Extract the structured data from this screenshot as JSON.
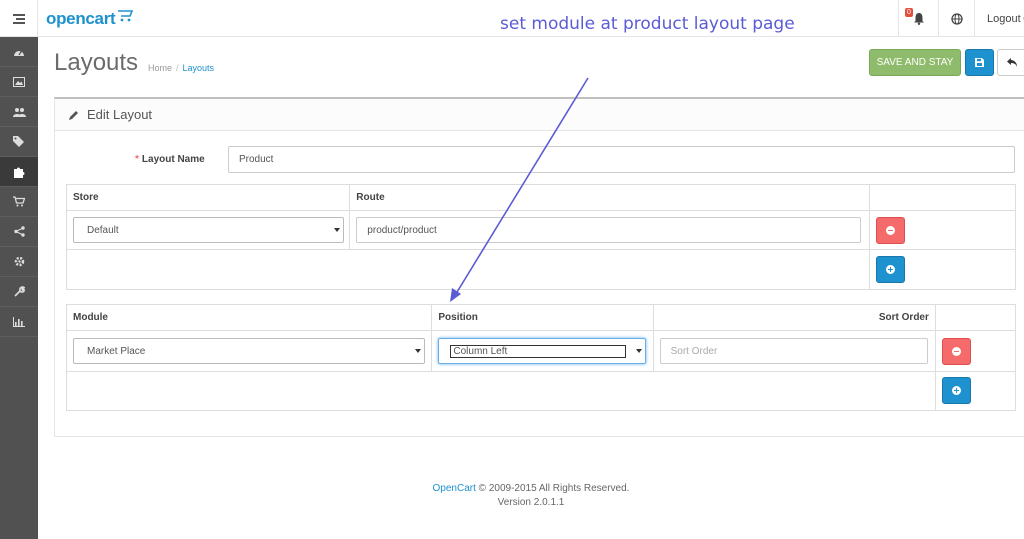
{
  "header": {
    "logo_text": "opencart",
    "annotation": "set module at product layout page",
    "notification_count": "0",
    "logout_label": "Logout"
  },
  "sidebar": {
    "items": [
      {
        "icon": "dashboard-icon"
      },
      {
        "icon": "image-icon"
      },
      {
        "icon": "users-icon"
      },
      {
        "icon": "tags-icon"
      },
      {
        "icon": "puzzle-icon",
        "active": true
      },
      {
        "icon": "cart-icon"
      },
      {
        "icon": "share-icon"
      },
      {
        "icon": "gear-icon"
      },
      {
        "icon": "wrench-icon"
      },
      {
        "icon": "bar-chart-icon"
      }
    ]
  },
  "page": {
    "title": "Layouts",
    "breadcrumb": [
      "Home",
      "Layouts"
    ],
    "save_stay_label": "SAVE AND STAY"
  },
  "panel": {
    "heading": "Edit Layout",
    "layout_name_label": "Layout Name",
    "layout_name_value": "Product"
  },
  "route_table": {
    "headers": [
      "Store",
      "Route"
    ],
    "rows": [
      {
        "store": "Default",
        "route": "product/product"
      }
    ]
  },
  "module_table": {
    "headers": [
      "Module",
      "Position",
      "Sort Order"
    ],
    "rows": [
      {
        "module": "Market Place",
        "position": "Column Left",
        "sort_order_placeholder": "Sort Order"
      }
    ]
  },
  "footer": {
    "link": "OpenCart",
    "copyright": "© 2009-2015 All Rights Reserved.",
    "version": "Version 2.0.1.1"
  },
  "colors": {
    "brand": "#1e91cf",
    "sidebar": "#515151",
    "success": "#8fbb6c",
    "danger": "#f56b6b",
    "annotation": "#5b5bd6"
  }
}
